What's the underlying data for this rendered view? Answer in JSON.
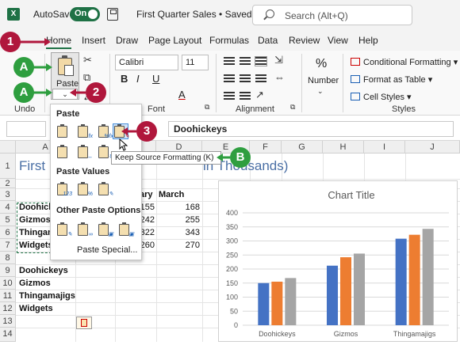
{
  "titlebar": {
    "autosave_label": "AutoSave",
    "toggle_state": "On",
    "doc_title": "First Quarter Sales • Saved",
    "search_placeholder": "Search (Alt+Q)"
  },
  "tabs": [
    "Home",
    "Insert",
    "Draw",
    "Page Layout",
    "Formulas",
    "Data",
    "Review",
    "View",
    "Help"
  ],
  "active_tab": "Home",
  "ribbon": {
    "clipboard": {
      "paste_label": "Paste",
      "group_label": "Undo"
    },
    "font": {
      "name": "Calibri",
      "size": "11",
      "bold": "B",
      "italic": "I",
      "underline": "U",
      "font_color": "A",
      "group_label": "Font"
    },
    "alignment": {
      "group_label": "Alignment"
    },
    "number": {
      "label": "Number",
      "symbol": "%"
    },
    "styles": {
      "items": [
        "Conditional Formatting",
        "Format as Table",
        "Cell Styles"
      ],
      "group_label": "Styles"
    }
  },
  "formula_bar": {
    "value": "Doohickeys"
  },
  "grid": {
    "columns": [
      "A",
      "B",
      "C",
      "D",
      "E",
      "F",
      "G",
      "H",
      "I",
      "J"
    ],
    "rows": [
      "1",
      "2",
      "3",
      "4",
      "5",
      "6",
      "7",
      "8",
      "9",
      "10",
      "11",
      "12",
      "13",
      "14"
    ],
    "title_left": "First",
    "title_right": "in Thousands)",
    "header_feb": "ary",
    "header_march": "March",
    "upper_labels": [
      "Doohick",
      "Gizmos",
      "Thingan",
      "Widgets"
    ],
    "feb_values": [
      "155",
      "242",
      "322",
      "260"
    ],
    "march_values": [
      "168",
      "255",
      "343",
      "270"
    ],
    "lower_labels": [
      "Doohickeys",
      "Gizmos",
      "Thingamajigs",
      "Widgets"
    ]
  },
  "paste_menu": {
    "paste_heading": "Paste",
    "values_heading": "Paste Values",
    "other_heading": "Other Paste Options",
    "special_label": "Paste Special...",
    "tooltip": "Keep Source Formatting (K)"
  },
  "callouts": {
    "home": "1",
    "dropdown": "2",
    "keep_source": "3",
    "a_label": "A",
    "b_label": "B"
  },
  "chart_data": {
    "type": "bar",
    "title": "Chart Title",
    "categories": [
      "Doohickeys",
      "Gizmos",
      "Thingamajigs"
    ],
    "series": [
      {
        "values": [
          150,
          212,
          308
        ],
        "color": "#4472c4"
      },
      {
        "values": [
          155,
          242,
          322
        ],
        "color": "#ed7d31"
      },
      {
        "values": [
          168,
          255,
          343
        ],
        "color": "#a5a5a5"
      }
    ],
    "ylim": [
      0,
      400
    ],
    "yticks": [
      "0",
      "50",
      "100",
      "150",
      "200",
      "250",
      "300",
      "350",
      "400"
    ],
    "grid": true
  }
}
